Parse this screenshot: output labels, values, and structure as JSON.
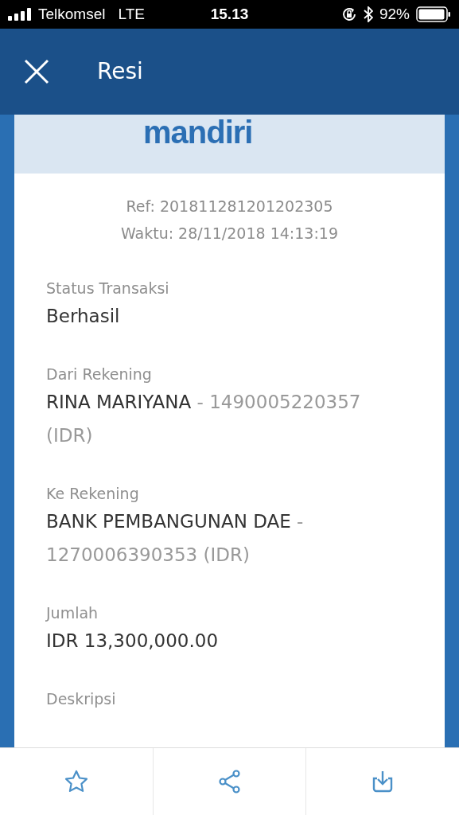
{
  "status_bar": {
    "carrier": "Telkomsel",
    "network": "LTE",
    "time": "15.13",
    "battery": "92%"
  },
  "header": {
    "title": "Resi"
  },
  "logo": {
    "text": "mandiri"
  },
  "reference": [
    "Ref: 201811281201202305",
    "Waktu: 28/11/2018 14:13:19"
  ],
  "fields": [
    {
      "label": "Status Transaksi",
      "value": "Berhasil"
    },
    {
      "label": "Dari Rekening",
      "value": "RINA MARIYANA",
      "detail": " - 1490005220357 (IDR)"
    },
    {
      "label": "Ke Rekening",
      "value": "BANK PEMBANGUNAN DAE",
      "detail": " - 1270006390353 (IDR)"
    },
    {
      "label": "Jumlah",
      "value": "IDR 13,300,000.00"
    },
    {
      "label": "Deskripsi"
    }
  ],
  "toolbar": [
    {
      "kind": "favorite"
    },
    {
      "kind": "share"
    },
    {
      "kind": "download"
    }
  ]
}
